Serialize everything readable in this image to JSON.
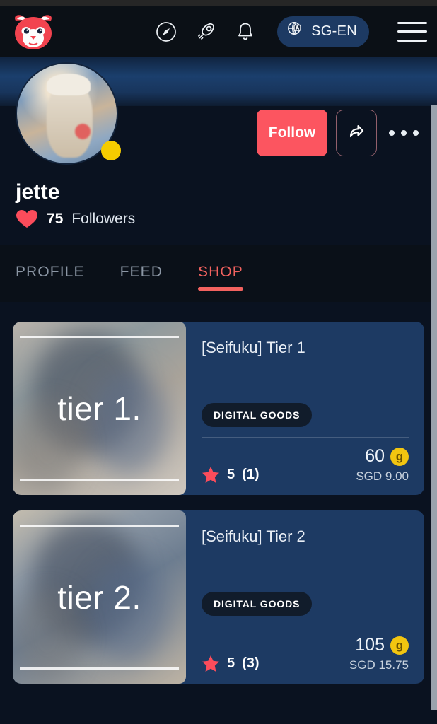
{
  "header": {
    "logo_name": "red-panda-logo",
    "icons": [
      {
        "name": "compass-icon",
        "label": "Explore"
      },
      {
        "name": "rocket-icon",
        "label": "Boost"
      },
      {
        "name": "bell-icon",
        "label": "Notifications"
      }
    ],
    "language_selector": {
      "label": "SG-EN",
      "icon": "translate-globe-icon"
    },
    "menu_label": "Menu"
  },
  "profile": {
    "username": "jette",
    "followers_count": "75",
    "followers_suffix": "Followers",
    "follow_label": "Follow",
    "share_label": "Share",
    "more_label": "More options",
    "status": "online",
    "status_color": "#f5cc00",
    "accent_color": "#fc5560"
  },
  "tabs": [
    {
      "label": "PROFILE",
      "active": false
    },
    {
      "label": "FEED",
      "active": false
    },
    {
      "label": "SHOP",
      "active": true
    }
  ],
  "products": [
    {
      "title": "[Seifuku] Tier 1",
      "thumb_label": "tier 1.",
      "badge": "DIGITAL GOODS",
      "rating": "5",
      "rating_count": "(1)",
      "coins": "60",
      "coin_glyph": "g",
      "fiat_price": "SGD 9.00"
    },
    {
      "title": "[Seifuku] Tier 2",
      "thumb_label": "tier 2.",
      "badge": "DIGITAL GOODS",
      "rating": "5",
      "rating_count": "(3)",
      "coins": "105",
      "coin_glyph": "g",
      "fiat_price": "SGD 15.75"
    }
  ],
  "colors": {
    "page_background": "#0a1018",
    "card_background": "#1d3a63",
    "accent_red": "#fc5560",
    "coin_yellow": "#f2c510",
    "tab_active": "#f2625f"
  }
}
